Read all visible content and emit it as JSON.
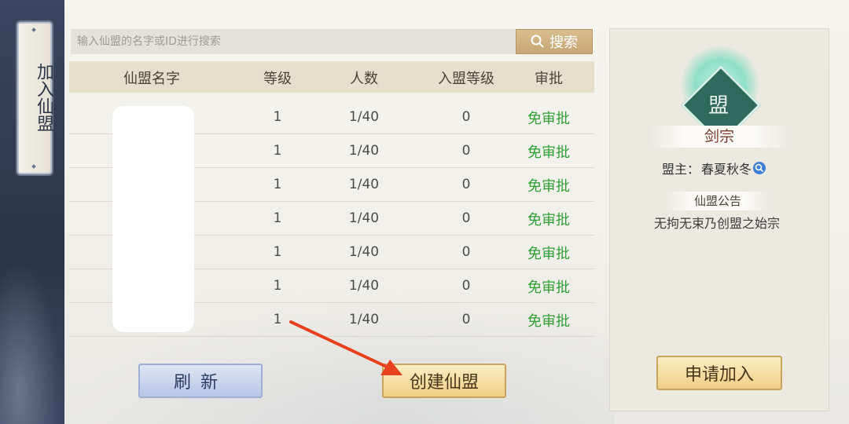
{
  "side_tab": {
    "label": "加入仙盟"
  },
  "search": {
    "placeholder": "输入仙盟的名字或ID进行搜索",
    "button_label": "搜索"
  },
  "table": {
    "headers": [
      "仙盟名字",
      "等级",
      "人数",
      "入盟等级",
      "审批"
    ],
    "rows": [
      {
        "level": "1",
        "members": "1/40",
        "join_level": "0",
        "approval": "免审批"
      },
      {
        "level": "1",
        "members": "1/40",
        "join_level": "0",
        "approval": "免审批"
      },
      {
        "level": "1",
        "members": "1/40",
        "join_level": "0",
        "approval": "免审批"
      },
      {
        "level": "1",
        "members": "1/40",
        "join_level": "0",
        "approval": "免审批"
      },
      {
        "level": "1",
        "members": "1/40",
        "join_level": "0",
        "approval": "免审批"
      },
      {
        "level": "1",
        "members": "1/40",
        "join_level": "0",
        "approval": "免审批"
      },
      {
        "level": "1",
        "members": "1/40",
        "join_level": "0",
        "approval": "免审批"
      }
    ]
  },
  "buttons": {
    "refresh": "刷新",
    "create": "创建仙盟",
    "apply": "申请加入"
  },
  "detail": {
    "emblem_char": "盟",
    "sect_name": "剑宗",
    "leader_label": "盟主：",
    "leader_name": "春夏秋冬",
    "notice_title": "仙盟公告",
    "notice_text": "无拘无束乃创盟之始宗"
  },
  "colors": {
    "approval_green": "#2fa035",
    "annotation_arrow": "#e8401c"
  }
}
